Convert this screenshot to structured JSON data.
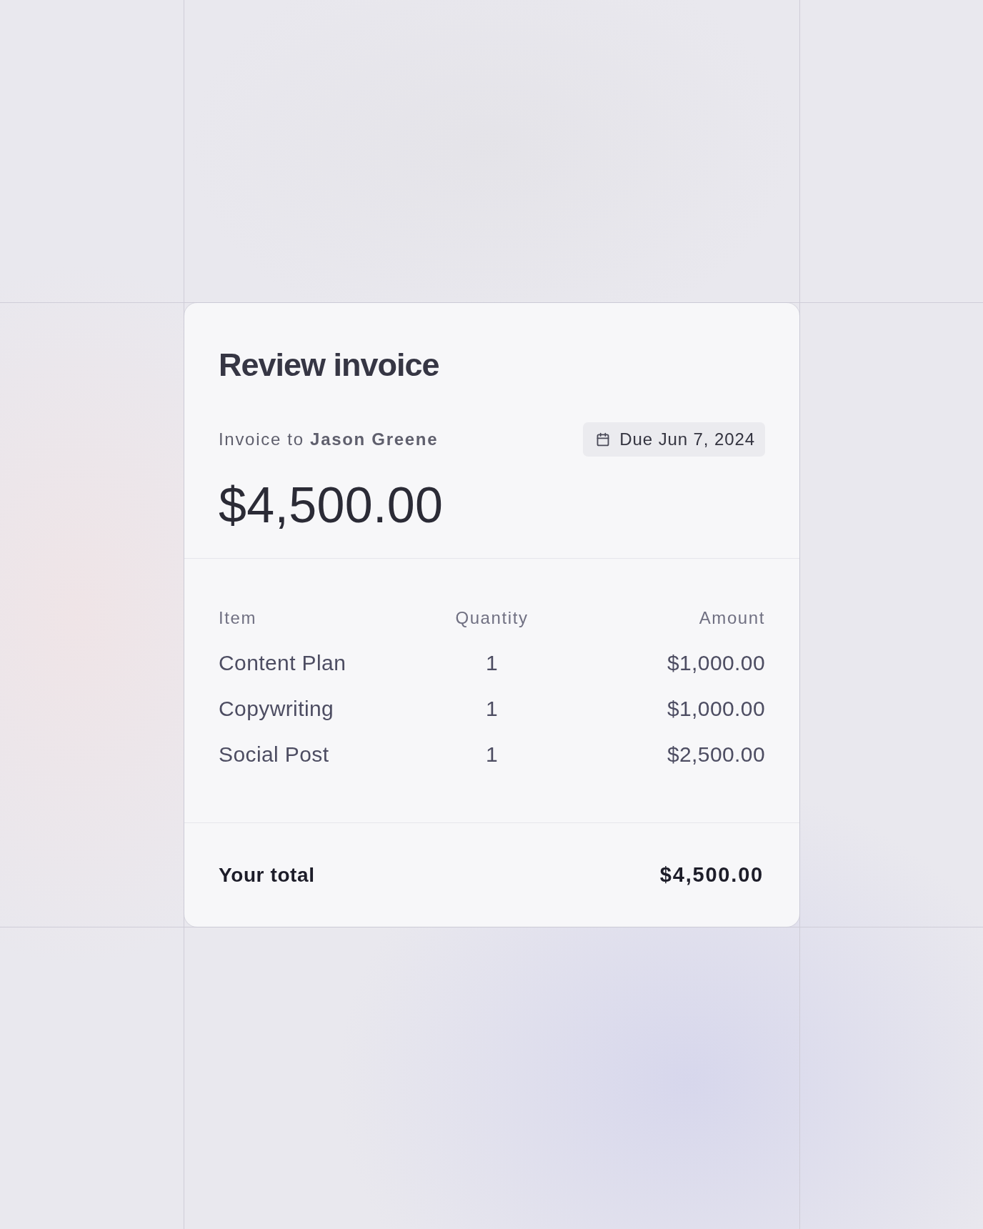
{
  "card": {
    "title": "Review invoice",
    "recipient_line": "Invoice to **Jason Greene**",
    "due_date": "Due Jun 7, 2024",
    "amount": "$4,500.00"
  },
  "table": {
    "columns": [
      "Item",
      "Quantity",
      "Amount"
    ],
    "rows": [
      {
        "item": "Content Plan",
        "quantity": "1",
        "amount": "$1,000.00"
      },
      {
        "item": "Copywriting",
        "quantity": "1",
        "amount": "$1,000.00"
      },
      {
        "item": "Social Post",
        "quantity": "1",
        "amount": "$2,500.00"
      }
    ]
  },
  "total": {
    "label": "Your total",
    "value": "$4,500.00"
  }
}
